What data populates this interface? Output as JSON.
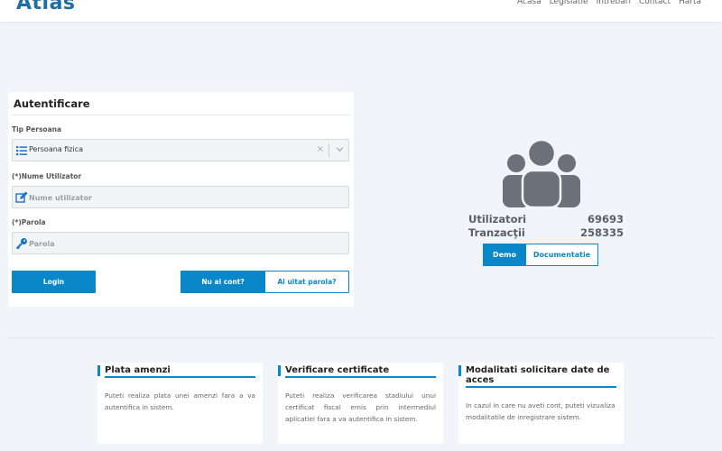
{
  "header": {
    "logo": "Atlas",
    "nav": [
      "Acasa",
      "Legislatie",
      "Intrebari",
      "Contact",
      "Harta"
    ]
  },
  "auth": {
    "title": "Autentificare",
    "tip_label": "Tip Persoana",
    "tip_value": "Persoana fizica",
    "user_label": "(*)Nume Utilizator",
    "user_placeholder": "Nume utilizator",
    "pass_label": "(*)Parola",
    "pass_placeholder": "Parola",
    "login": "Login",
    "no_account": "Nu ai cont?",
    "forgot": "Ai uitat parola?"
  },
  "stats": {
    "users_label": "Utilizatori",
    "users_value": "69693",
    "tx_label": "Tranzacţii",
    "tx_value": "258335",
    "demo": "Demo",
    "docs": "Documentatie"
  },
  "cards": [
    {
      "title": "Plata amenzi",
      "text": "Puteti realiza plata unei amenzi fara a va autentifica in sistem."
    },
    {
      "title": "Verificare certificate",
      "text": "Puteti realiza verificarea stadiului unui certificat fiscal emis prin intermediul aplicatiei fara a va autentifica in sistem."
    },
    {
      "title": "Modalitati solicitare date de acces",
      "text": "In cazul in care nu aveti cont, puteti vizualiza modalitatile de inregistrare sistem."
    }
  ],
  "colors": {
    "accent": "#0a87c8",
    "logo": "#1c6ea4",
    "icon": "#1a73c7",
    "people": "#6b7079"
  }
}
